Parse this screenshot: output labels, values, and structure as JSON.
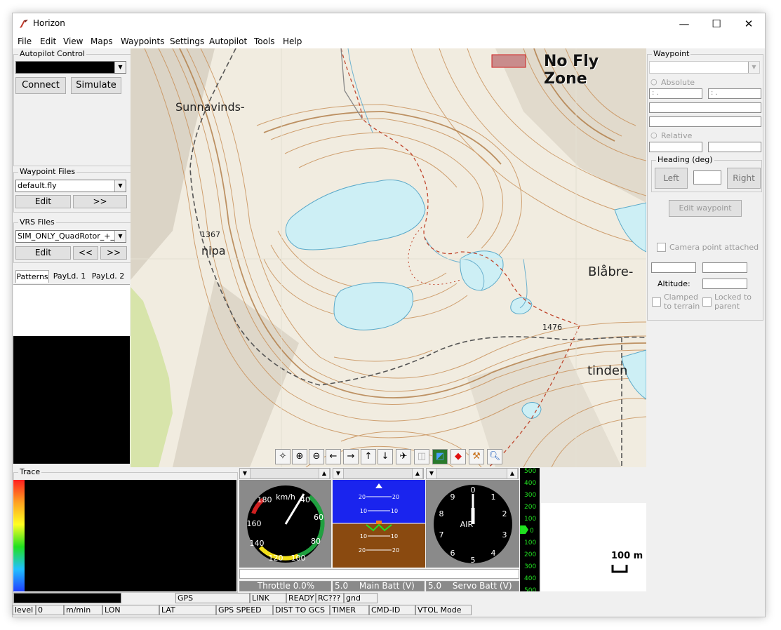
{
  "window": {
    "title": "Horizon",
    "minimize": "—",
    "maximize": "☐",
    "close": "✕"
  },
  "menu": [
    "File",
    "Edit",
    "View",
    "Maps",
    "Waypoints",
    "Settings",
    "Autopilot",
    "Tools",
    "Help"
  ],
  "autopilot": {
    "legend": "Autopilot Control",
    "combo_value": "",
    "connect": "Connect",
    "simulate": "Simulate"
  },
  "waypoint_files": {
    "legend": "Waypoint Files",
    "file": "default.fly",
    "edit": "Edit",
    "next": ">>"
  },
  "vrs_files": {
    "legend": "VRS Files",
    "file": "SIM_ONLY_QuadRotor_+_P",
    "edit": "Edit",
    "prev": "<<",
    "next": ">>"
  },
  "tabs": [
    "Patterns",
    "PayLd. 1",
    "PayLd. 2"
  ],
  "map": {
    "no_fly_zone": "No Fly Zone",
    "labels": {
      "sunnavinds": "Sunnavinds-",
      "nipa": "nipa",
      "blabre": "Blåbre-",
      "tinden": "tinden",
      "h1367": "1367",
      "h1476": "1476"
    },
    "scale": "100 m"
  },
  "map_toolbar": [
    "center-icon",
    "zoom-in-icon",
    "zoom-out-icon",
    "arrow-left-icon",
    "arrow-right-icon",
    "arrow-up-icon",
    "arrow-down-icon",
    "aircraft-icon",
    "camera-icon",
    "globe-icon",
    "diamond-icon",
    "tools-icon",
    "search-icon"
  ],
  "trace": {
    "legend": "Trace"
  },
  "gauges": {
    "airspeed_unit": "km/h",
    "airspeed_ticks": [
      "180",
      "40",
      "160",
      "60",
      "140",
      "80",
      "120",
      "100"
    ],
    "horizon_pitch": [
      "20",
      "20",
      "10",
      "10",
      "10",
      "10",
      "20",
      "20"
    ],
    "altimeter_label": "AIR",
    "altimeter_ticks": [
      "0",
      "1",
      "2",
      "3",
      "4",
      "5",
      "6",
      "7",
      "8",
      "9"
    ],
    "throttle": "Throttle 0.0%",
    "main_batt_value": "5.0",
    "main_batt": "Main Batt (V)",
    "servo_batt_value": "5.0",
    "servo_batt": "Servo Batt (V)",
    "vsi_ticks": [
      "500",
      "400",
      "300",
      "200",
      "100",
      "0",
      "100",
      "200",
      "300",
      "400",
      "500"
    ]
  },
  "waypoint_panel": {
    "legend": "Waypoint",
    "absolute": "Absolute",
    "abs_lat": " : .",
    "abs_lon": " : .",
    "relative": "Relative",
    "heading_legend": "Heading (deg)",
    "left": "Left",
    "right": "Right",
    "edit_waypoint": "Edit waypoint",
    "camera_point": "Camera point attached",
    "altitude": "Altitude:",
    "clamped": "Clamped to terrain",
    "clamped1": "Clamped",
    "clamped2": "to terrain",
    "locked1": "Locked to",
    "locked2": "parent"
  },
  "status_row1": {
    "gps": "GPS",
    "link": "LINK",
    "ready": "READY",
    "rc": "RC???",
    "gnd": "gnd"
  },
  "status_row2": {
    "level": "level",
    "level_value": "0",
    "rate_unit": "m/min",
    "lon": "LON",
    "lat": "LAT",
    "gps_speed": "GPS SPEED",
    "dist": "DIST TO GCS",
    "timer": "TIMER",
    "cmd": "CMD-ID",
    "vtol": "VTOL Mode"
  }
}
